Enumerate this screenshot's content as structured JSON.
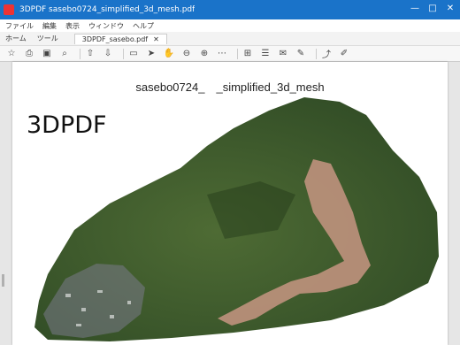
{
  "window": {
    "title": "3DPDF sasebo0724_simplified_3d_mesh.pdf",
    "buttons": [
      "—",
      "□",
      "✕"
    ]
  },
  "menubar": {
    "items": [
      "ファイル",
      "編集",
      "表示",
      "ウィンドウ",
      "ヘルプ"
    ]
  },
  "tabs": {
    "nav": [
      "ホーム",
      "ツール"
    ],
    "document": "3DPDF_sasebo.pdf",
    "close": "✕"
  },
  "toolbar": {
    "icons": [
      "star-icon",
      "print-icon",
      "save-icon",
      "search-icon",
      "upload-icon",
      "download-icon",
      "page-nav-icon",
      "cursor-icon",
      "hand-icon",
      "zoom-out-icon",
      "zoom-in-icon",
      "more-icon",
      "fit-page-icon",
      "scroll-icon",
      "comment-icon",
      "pen-icon",
      "share-icon",
      "edit-icon"
    ]
  },
  "document": {
    "title": "sasebo0724_　_simplified_3d_mesh",
    "watermark": "3DPDF"
  },
  "colors": {
    "titlebar": "#1a73c9",
    "vegetation": "#3c5a2a",
    "landslide_scar": "#b88f79"
  }
}
